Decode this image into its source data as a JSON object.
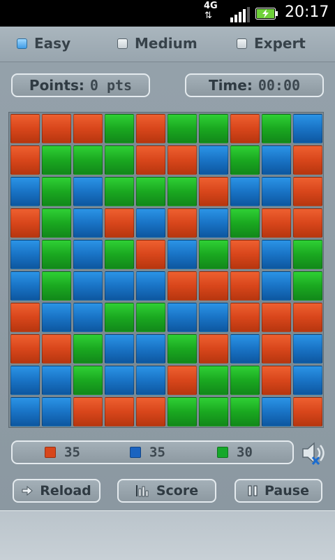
{
  "status_bar": {
    "network": "4G",
    "network_arrows": "⇅",
    "time": "20:17"
  },
  "difficulty": {
    "options": [
      {
        "label": "Easy",
        "selected": true
      },
      {
        "label": "Medium",
        "selected": false
      },
      {
        "label": "Expert",
        "selected": false
      }
    ]
  },
  "stats": {
    "points_label": "Points:",
    "points_value": "0 pts",
    "time_label": "Time:",
    "time_value": "00:00"
  },
  "colors": {
    "r": "#d8461b",
    "g": "#1aa820",
    "b": "#1973c5"
  },
  "board": [
    "RRRGRGGRGB",
    "RGGGRRBGBR",
    "BGBGGGRBBR",
    "RGBRBRBGRR",
    "BGBGRBGRBG",
    "BGBBBRRRBG",
    "RBBGGBBRRR",
    "RRGBBGRBRB",
    "BBGBBRGGRB",
    "BBRRRGGGBR"
  ],
  "counts": {
    "red": "35",
    "blue": "35",
    "green": "30"
  },
  "sound": {
    "icon": "speaker-muted-icon"
  },
  "buttons": {
    "reload": "Reload",
    "score": "Score",
    "pause": "Pause"
  }
}
